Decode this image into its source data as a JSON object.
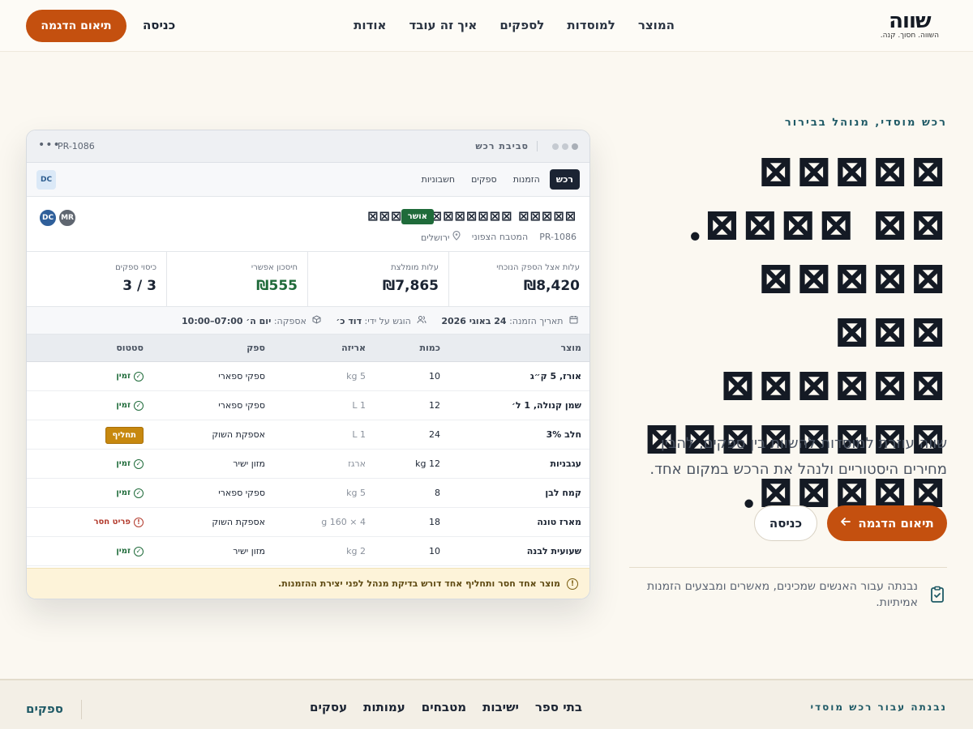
{
  "nav": {
    "logo": "שווה",
    "tagline": "השווה. חסוך. קנה.",
    "menu": [
      "המוצר",
      "למוסדות",
      "לספקים",
      "איך זה עובד",
      "אודות"
    ],
    "login": "כניסה",
    "demo": "תיאום הדגמה"
  },
  "hero": {
    "eyebrow": "רכש מוסדי, מנוהל בבירור",
    "title": "⊠⊠⊠⊠⊠ ⊠⊠ ⊠⊠⊠⊠. ⊠⊠⊠⊠⊠ ⊠⊠⊠ ⊠⊠⊠⊠⊠⊠ ⊠⊠⊠⊠⊠⊠⊠⊠ ⊠⊠⊠⊠⊠.",
    "subtitle": "שווה עוזרת למוסדות להשוות בין ספקים, להבין מחירים היסטוריים ולנהל את הרכש במקום אחד.",
    "demo": "תיאום הדגמה",
    "login": "כניסה",
    "note": "נבנתה עבור האנשים שמכינים, מאשרים ומבצעים הזמנות אמיתיות."
  },
  "window": {
    "title": "סביבת רכש",
    "id": "PR-1086",
    "more": "•••",
    "tabs": [
      "רכש",
      "הזמנות",
      "ספקים",
      "חשבוניות"
    ],
    "tab_avatar": "DC",
    "order": {
      "title": "⊠⊠⊠⊠⊠ ⊠⊠⊠⊠⊠⊠⊠ ⊠⊠⊠⊠⊠",
      "badge": "אושר",
      "id": "PR-1086",
      "kitchen": "המטבח הצפוני",
      "city": "ירושלים",
      "avatars": [
        "DC",
        "MR"
      ]
    },
    "stats": [
      {
        "label": "עלות אצל הספק הנוכחי",
        "value": "₪8,420"
      },
      {
        "label": "עלות מומלצת",
        "value": "₪7,865"
      },
      {
        "label": "חיסכון אפשרי",
        "value": "₪555"
      },
      {
        "label": "כיסוי ספקים",
        "value": "3 / 3"
      }
    ],
    "info": {
      "date_label": "תאריך הזמנה:",
      "date_value": "24 באוגי 2026",
      "by_label": "הוגש על ידי:",
      "by_value": "דוד כ׳",
      "supply_label": "אספקה:",
      "supply_value": "יום ה׳ 07:00–10:00"
    },
    "table": {
      "headers": [
        "מוצר",
        "כמות",
        "אריזה",
        "ספק",
        "סטטוס"
      ],
      "rows": [
        {
          "product": "אורז, 5 ק״ג",
          "qty": "10",
          "pack": "5 kg",
          "supplier": "ספקי ספארי",
          "status": "זמין",
          "kind": "ok"
        },
        {
          "product": "שמן קנולה, 1 ל׳",
          "qty": "12",
          "pack": "1 L",
          "supplier": "ספקי ספארי",
          "status": "זמין",
          "kind": "ok"
        },
        {
          "product": "חלב 3%",
          "qty": "24",
          "pack": "1 L",
          "supplier": "אספקת השוק",
          "status": "תחליף",
          "kind": "sub"
        },
        {
          "product": "עגבניות",
          "qty": "12 kg",
          "pack": "ארגז",
          "supplier": "מזון ישיר",
          "status": "זמין",
          "kind": "ok"
        },
        {
          "product": "קמח לבן",
          "qty": "8",
          "pack": "5 kg",
          "supplier": "ספקי ספארי",
          "status": "זמין",
          "kind": "ok"
        },
        {
          "product": "מארז טונה",
          "qty": "18",
          "pack": "4 × 160 g",
          "supplier": "אספקת השוק",
          "status": "פריט חסר",
          "kind": "miss"
        },
        {
          "product": "שעועית לבנה",
          "qty": "10",
          "pack": "2 kg",
          "supplier": "מזון ישיר",
          "status": "זמין",
          "kind": "ok"
        }
      ]
    },
    "warning": "מוצר אחד חסר ותחליף אחד דורש בדיקת מנהל לפני יצירת ההזמנות."
  },
  "footer": {
    "built_for": "נבנתה עבור רכש מוסדי",
    "links": [
      "בתי ספר",
      "ישיבות",
      "מטבחים",
      "עמותות",
      "עסקים"
    ],
    "suppliers": "ספקים"
  },
  "colors": {
    "accent": "#c4500f",
    "teal": "#1f5a66",
    "green": "#1f6b3a",
    "warning": "#c7880f"
  }
}
